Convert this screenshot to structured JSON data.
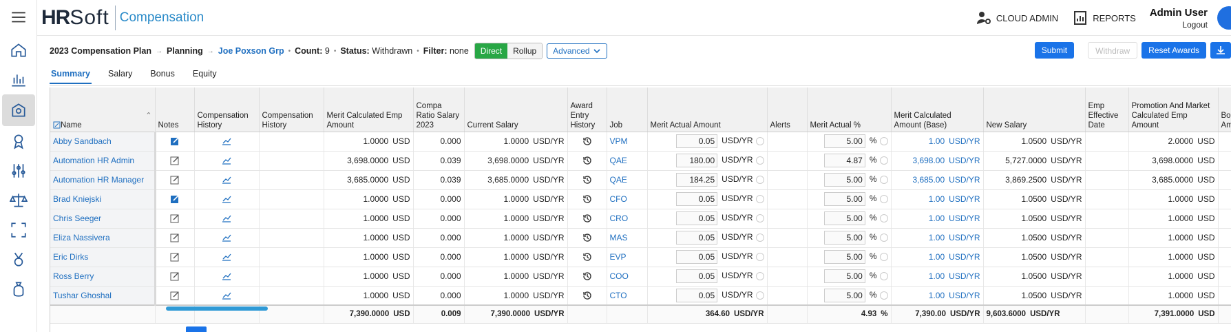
{
  "app": {
    "brand_hr": "HR",
    "brand_soft": "Soft",
    "product": "Compensation"
  },
  "top": {
    "cloud_admin": "CLOUD ADMIN",
    "reports": "REPORTS",
    "user_name": "Admin User",
    "logout": "Logout"
  },
  "breadcrumb": {
    "plan": "2023 Compensation Plan",
    "planning": "Planning",
    "group": "Joe Poxson Grp",
    "count_label": "Count:",
    "count": "9",
    "status_label": "Status:",
    "status": "Withdrawn",
    "filter_label": "Filter:",
    "filter": "none",
    "direct": "Direct",
    "rollup": "Rollup",
    "advanced": "Advanced"
  },
  "actions": {
    "submit": "Submit",
    "withdraw": "Withdraw",
    "reset": "Reset Awards"
  },
  "tabs": [
    "Summary",
    "Salary",
    "Bonus",
    "Equity"
  ],
  "columns": [
    "Name",
    "Notes",
    "Compensation History",
    "Compensation History",
    "Merit Calculated Emp Amount",
    "Compa Ratio Salary 2023",
    "Current Salary",
    "Award Entry History",
    "Job",
    "Merit Actual Amount",
    "Alerts",
    "Merit Actual %",
    "Merit Calculated Amount (Base)",
    "New Salary",
    "Emp Effective Date",
    "Promotion And Market Calculated Emp Amount",
    "Bonus Amou"
  ],
  "units": {
    "usd": "USD",
    "usd_yr": "USD/YR",
    "pct": "%"
  },
  "rows": [
    {
      "name": "Abby Sandbach",
      "note_active": true,
      "merit_calc": "1.0000",
      "compa": "0.000",
      "current": "1.0000",
      "job": "VPM",
      "merit_actual": "0.05",
      "merit_pct": "5.00",
      "merit_base": "1.00",
      "new_salary": "1.0500",
      "promo": "2.0000"
    },
    {
      "name": "Automation HR Admin",
      "note_active": false,
      "merit_calc": "3,698.0000",
      "compa": "0.039",
      "current": "3,698.0000",
      "job": "QAE",
      "merit_actual": "180.00",
      "merit_pct": "4.87",
      "merit_base": "3,698.00",
      "new_salary": "5,727.0000",
      "promo": "3,698.0000"
    },
    {
      "name": "Automation HR Manager",
      "note_active": false,
      "merit_calc": "3,685.0000",
      "compa": "0.039",
      "current": "3,685.0000",
      "job": "QAE",
      "merit_actual": "184.25",
      "merit_pct": "5.00",
      "merit_base": "3,685.00",
      "new_salary": "3,869.2500",
      "promo": "3,685.0000"
    },
    {
      "name": "Brad Kniejski",
      "note_active": true,
      "merit_calc": "1.0000",
      "compa": "0.000",
      "current": "1.0000",
      "job": "CFO",
      "merit_actual": "0.05",
      "merit_pct": "5.00",
      "merit_base": "1.00",
      "new_salary": "1.0500",
      "promo": "1.0000"
    },
    {
      "name": "Chris Seeger",
      "note_active": false,
      "merit_calc": "1.0000",
      "compa": "0.000",
      "current": "1.0000",
      "job": "CRO",
      "merit_actual": "0.05",
      "merit_pct": "5.00",
      "merit_base": "1.00",
      "new_salary": "1.0500",
      "promo": "1.0000"
    },
    {
      "name": "Eliza Nassivera",
      "note_active": false,
      "merit_calc": "1.0000",
      "compa": "0.000",
      "current": "1.0000",
      "job": "MAS",
      "merit_actual": "0.05",
      "merit_pct": "5.00",
      "merit_base": "1.00",
      "new_salary": "1.0500",
      "promo": "1.0000"
    },
    {
      "name": "Eric Dirks",
      "note_active": false,
      "merit_calc": "1.0000",
      "compa": "0.000",
      "current": "1.0000",
      "job": "EVP",
      "merit_actual": "0.05",
      "merit_pct": "5.00",
      "merit_base": "1.00",
      "new_salary": "1.0500",
      "promo": "1.0000"
    },
    {
      "name": "Ross Berry",
      "note_active": false,
      "merit_calc": "1.0000",
      "compa": "0.000",
      "current": "1.0000",
      "job": "COO",
      "merit_actual": "0.05",
      "merit_pct": "5.00",
      "merit_base": "1.00",
      "new_salary": "1.0500",
      "promo": "1.0000"
    },
    {
      "name": "Tushar Ghoshal",
      "note_active": false,
      "merit_calc": "1.0000",
      "compa": "0.000",
      "current": "1.0000",
      "job": "CTO",
      "merit_actual": "0.05",
      "merit_pct": "5.00",
      "merit_base": "1.00",
      "new_salary": "1.0500",
      "promo": "1.0000"
    }
  ],
  "totals": {
    "merit_calc": "7,390.0000",
    "compa": "0.009",
    "current": "7,390.0000",
    "merit_actual": "364.60",
    "merit_pct": "4.93",
    "merit_base": "7,390.00",
    "new_salary": "9,603.6000",
    "promo": "7,391.0000"
  },
  "rail_icons": [
    "home-icon",
    "chart-icon",
    "compensation-icon",
    "award-icon",
    "sliders-icon",
    "scales-icon",
    "expand-icon",
    "medal-icon",
    "money-bag-icon"
  ]
}
